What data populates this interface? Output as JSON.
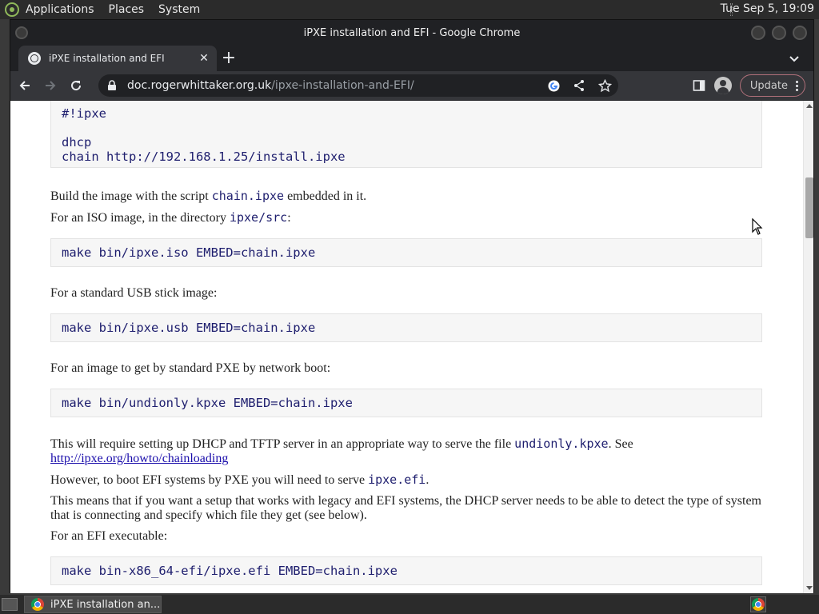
{
  "top_panel": {
    "menus": [
      "Applications",
      "Places",
      "System"
    ],
    "clock": "Tue Sep  5, 19:09"
  },
  "window": {
    "title": "iPXE installation and EFI - Google Chrome",
    "tab_title": "iPXE installation and EFI",
    "url_domain": "doc.rogerwhittaker.org.uk",
    "url_path": "/ipxe-installation-and-EFI/",
    "update_label": "Update"
  },
  "content": {
    "code1": "#!ipxe\n\ndhcp\nchain http://192.168.1.25/install.ipxe",
    "p1_pre": "Build the image with the script ",
    "p1_code": "chain.ipxe",
    "p1_post": " embedded in it.",
    "p2_pre": "For an ISO image, in the directory ",
    "p2_code": "ipxe/src",
    "p2_post": ":",
    "code2": "make bin/ipxe.iso EMBED=chain.ipxe",
    "p3": "For a standard USB stick image:",
    "code3": "make bin/ipxe.usb EMBED=chain.ipxe",
    "p4": "For an image to get by standard PXE by network boot:",
    "code4": "make bin/undionly.kpxe EMBED=chain.ipxe",
    "p5_pre": "This will require setting up DHCP and TFTP server in an appropriate way to serve the file ",
    "p5_code": "undionly.kpxe",
    "p5_post": ". See",
    "p5_link": "http://ipxe.org/howto/chainloading",
    "p6_pre": "However, to boot EFI systems by PXE you will need to serve ",
    "p6_code": "ipxe.efi",
    "p6_post": ".",
    "p7": "This means that if you want a setup that works with legacy and EFI systems, the DHCP server needs to be able to detect the type of system that is connecting and specify which file they get (see below).",
    "p8": "For an EFI executable:",
    "code5": "make bin-x86_64-efi/ipxe.efi EMBED=chain.ipxe"
  },
  "taskbar": {
    "task_label": "iPXE installation an..."
  }
}
